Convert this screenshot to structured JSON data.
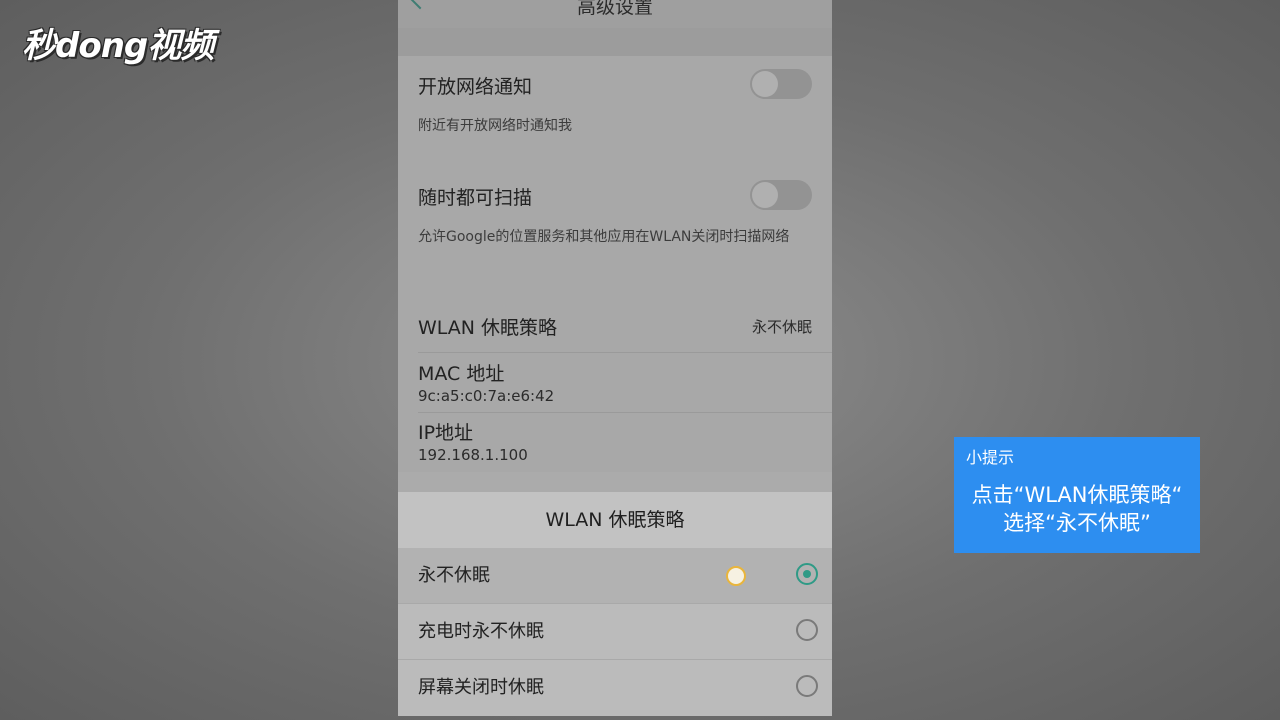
{
  "watermark": {
    "logo_text": "秒dong视频"
  },
  "screen": {
    "header": {
      "title": "高级设置",
      "back_icon": "chevron-left-icon"
    },
    "settings": {
      "open_network_notify": {
        "title": "开放网络通知",
        "subtitle": "附近有开放网络时通知我",
        "enabled": false
      },
      "always_scan": {
        "title": "随时都可扫描",
        "subtitle": "允许Google的位置服务和其他应用在WLAN关闭时扫描网络",
        "enabled": false
      },
      "wlan_sleep": {
        "title": "WLAN 休眠策略",
        "value": "永不休眠"
      },
      "mac": {
        "title": "MAC 地址",
        "value": "9c:a5:c0:7a:e6:42"
      },
      "ip": {
        "title": "IP地址",
        "value": "192.168.1.100"
      }
    },
    "dialog": {
      "title": "WLAN 休眠策略",
      "options": [
        {
          "label": "永不休眠",
          "selected": true
        },
        {
          "label": "充电时永不休眠",
          "selected": false
        },
        {
          "label": "屏幕关闭时休眠",
          "selected": false
        }
      ]
    }
  },
  "tip": {
    "title": "小提示",
    "line1": "点击“WLAN休眠策略“",
    "line2": "选择“永不休眠”"
  },
  "colors": {
    "accent": "#2f9a86",
    "tip_background": "#2d8ef0",
    "touch_indicator": "#e9b53c"
  }
}
